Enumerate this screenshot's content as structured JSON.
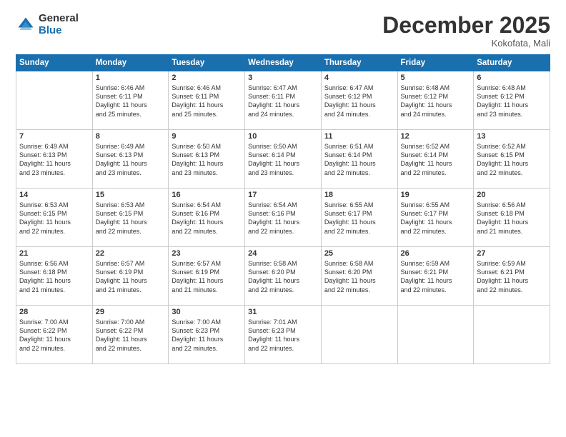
{
  "logo": {
    "general": "General",
    "blue": "Blue"
  },
  "header": {
    "month": "December 2025",
    "location": "Kokofata, Mali"
  },
  "weekdays": [
    "Sunday",
    "Monday",
    "Tuesday",
    "Wednesday",
    "Thursday",
    "Friday",
    "Saturday"
  ],
  "weeks": [
    [
      {
        "day": "",
        "detail": ""
      },
      {
        "day": "1",
        "detail": "Sunrise: 6:46 AM\nSunset: 6:11 PM\nDaylight: 11 hours\nand 25 minutes."
      },
      {
        "day": "2",
        "detail": "Sunrise: 6:46 AM\nSunset: 6:11 PM\nDaylight: 11 hours\nand 25 minutes."
      },
      {
        "day": "3",
        "detail": "Sunrise: 6:47 AM\nSunset: 6:11 PM\nDaylight: 11 hours\nand 24 minutes."
      },
      {
        "day": "4",
        "detail": "Sunrise: 6:47 AM\nSunset: 6:12 PM\nDaylight: 11 hours\nand 24 minutes."
      },
      {
        "day": "5",
        "detail": "Sunrise: 6:48 AM\nSunset: 6:12 PM\nDaylight: 11 hours\nand 24 minutes."
      },
      {
        "day": "6",
        "detail": "Sunrise: 6:48 AM\nSunset: 6:12 PM\nDaylight: 11 hours\nand 23 minutes."
      }
    ],
    [
      {
        "day": "7",
        "detail": "Sunrise: 6:49 AM\nSunset: 6:13 PM\nDaylight: 11 hours\nand 23 minutes."
      },
      {
        "day": "8",
        "detail": "Sunrise: 6:49 AM\nSunset: 6:13 PM\nDaylight: 11 hours\nand 23 minutes."
      },
      {
        "day": "9",
        "detail": "Sunrise: 6:50 AM\nSunset: 6:13 PM\nDaylight: 11 hours\nand 23 minutes."
      },
      {
        "day": "10",
        "detail": "Sunrise: 6:50 AM\nSunset: 6:14 PM\nDaylight: 11 hours\nand 23 minutes."
      },
      {
        "day": "11",
        "detail": "Sunrise: 6:51 AM\nSunset: 6:14 PM\nDaylight: 11 hours\nand 22 minutes."
      },
      {
        "day": "12",
        "detail": "Sunrise: 6:52 AM\nSunset: 6:14 PM\nDaylight: 11 hours\nand 22 minutes."
      },
      {
        "day": "13",
        "detail": "Sunrise: 6:52 AM\nSunset: 6:15 PM\nDaylight: 11 hours\nand 22 minutes."
      }
    ],
    [
      {
        "day": "14",
        "detail": "Sunrise: 6:53 AM\nSunset: 6:15 PM\nDaylight: 11 hours\nand 22 minutes."
      },
      {
        "day": "15",
        "detail": "Sunrise: 6:53 AM\nSunset: 6:15 PM\nDaylight: 11 hours\nand 22 minutes."
      },
      {
        "day": "16",
        "detail": "Sunrise: 6:54 AM\nSunset: 6:16 PM\nDaylight: 11 hours\nand 22 minutes."
      },
      {
        "day": "17",
        "detail": "Sunrise: 6:54 AM\nSunset: 6:16 PM\nDaylight: 11 hours\nand 22 minutes."
      },
      {
        "day": "18",
        "detail": "Sunrise: 6:55 AM\nSunset: 6:17 PM\nDaylight: 11 hours\nand 22 minutes."
      },
      {
        "day": "19",
        "detail": "Sunrise: 6:55 AM\nSunset: 6:17 PM\nDaylight: 11 hours\nand 22 minutes."
      },
      {
        "day": "20",
        "detail": "Sunrise: 6:56 AM\nSunset: 6:18 PM\nDaylight: 11 hours\nand 21 minutes."
      }
    ],
    [
      {
        "day": "21",
        "detail": "Sunrise: 6:56 AM\nSunset: 6:18 PM\nDaylight: 11 hours\nand 21 minutes."
      },
      {
        "day": "22",
        "detail": "Sunrise: 6:57 AM\nSunset: 6:19 PM\nDaylight: 11 hours\nand 21 minutes."
      },
      {
        "day": "23",
        "detail": "Sunrise: 6:57 AM\nSunset: 6:19 PM\nDaylight: 11 hours\nand 21 minutes."
      },
      {
        "day": "24",
        "detail": "Sunrise: 6:58 AM\nSunset: 6:20 PM\nDaylight: 11 hours\nand 22 minutes."
      },
      {
        "day": "25",
        "detail": "Sunrise: 6:58 AM\nSunset: 6:20 PM\nDaylight: 11 hours\nand 22 minutes."
      },
      {
        "day": "26",
        "detail": "Sunrise: 6:59 AM\nSunset: 6:21 PM\nDaylight: 11 hours\nand 22 minutes."
      },
      {
        "day": "27",
        "detail": "Sunrise: 6:59 AM\nSunset: 6:21 PM\nDaylight: 11 hours\nand 22 minutes."
      }
    ],
    [
      {
        "day": "28",
        "detail": "Sunrise: 7:00 AM\nSunset: 6:22 PM\nDaylight: 11 hours\nand 22 minutes."
      },
      {
        "day": "29",
        "detail": "Sunrise: 7:00 AM\nSunset: 6:22 PM\nDaylight: 11 hours\nand 22 minutes."
      },
      {
        "day": "30",
        "detail": "Sunrise: 7:00 AM\nSunset: 6:23 PM\nDaylight: 11 hours\nand 22 minutes."
      },
      {
        "day": "31",
        "detail": "Sunrise: 7:01 AM\nSunset: 6:23 PM\nDaylight: 11 hours\nand 22 minutes."
      },
      {
        "day": "",
        "detail": ""
      },
      {
        "day": "",
        "detail": ""
      },
      {
        "day": "",
        "detail": ""
      }
    ]
  ]
}
